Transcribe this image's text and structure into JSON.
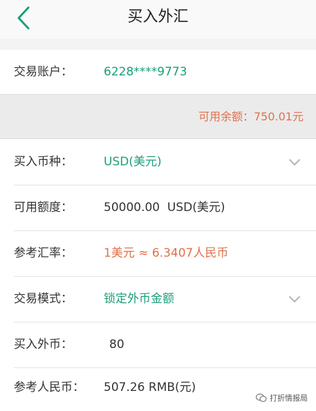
{
  "header": {
    "title": "买入外汇"
  },
  "account": {
    "label": "交易账户：",
    "value": "6228****9773"
  },
  "balance": {
    "text": "可用余额：750.01元"
  },
  "form": {
    "currency": {
      "label": "买入币种：",
      "value": "USD(美元)"
    },
    "quota": {
      "label": "可用额度：",
      "value": "50000.00  USD(美元)"
    },
    "rate": {
      "label": "参考汇率：",
      "value": "1美元 ≈ 6.3407人民币"
    },
    "mode": {
      "label": "交易模式：",
      "value": "锁定外币金额"
    },
    "amount": {
      "label": "买入外币：",
      "value": "80"
    },
    "rmb": {
      "label": "参考人民币：",
      "value": "507.26 RMB(元)"
    }
  },
  "watermark": {
    "text": "打折情报局"
  },
  "colors": {
    "accent_green": "#1b9e7a",
    "highlight_orange": "#e0704c",
    "chevron_gray": "#b5b5b5"
  }
}
